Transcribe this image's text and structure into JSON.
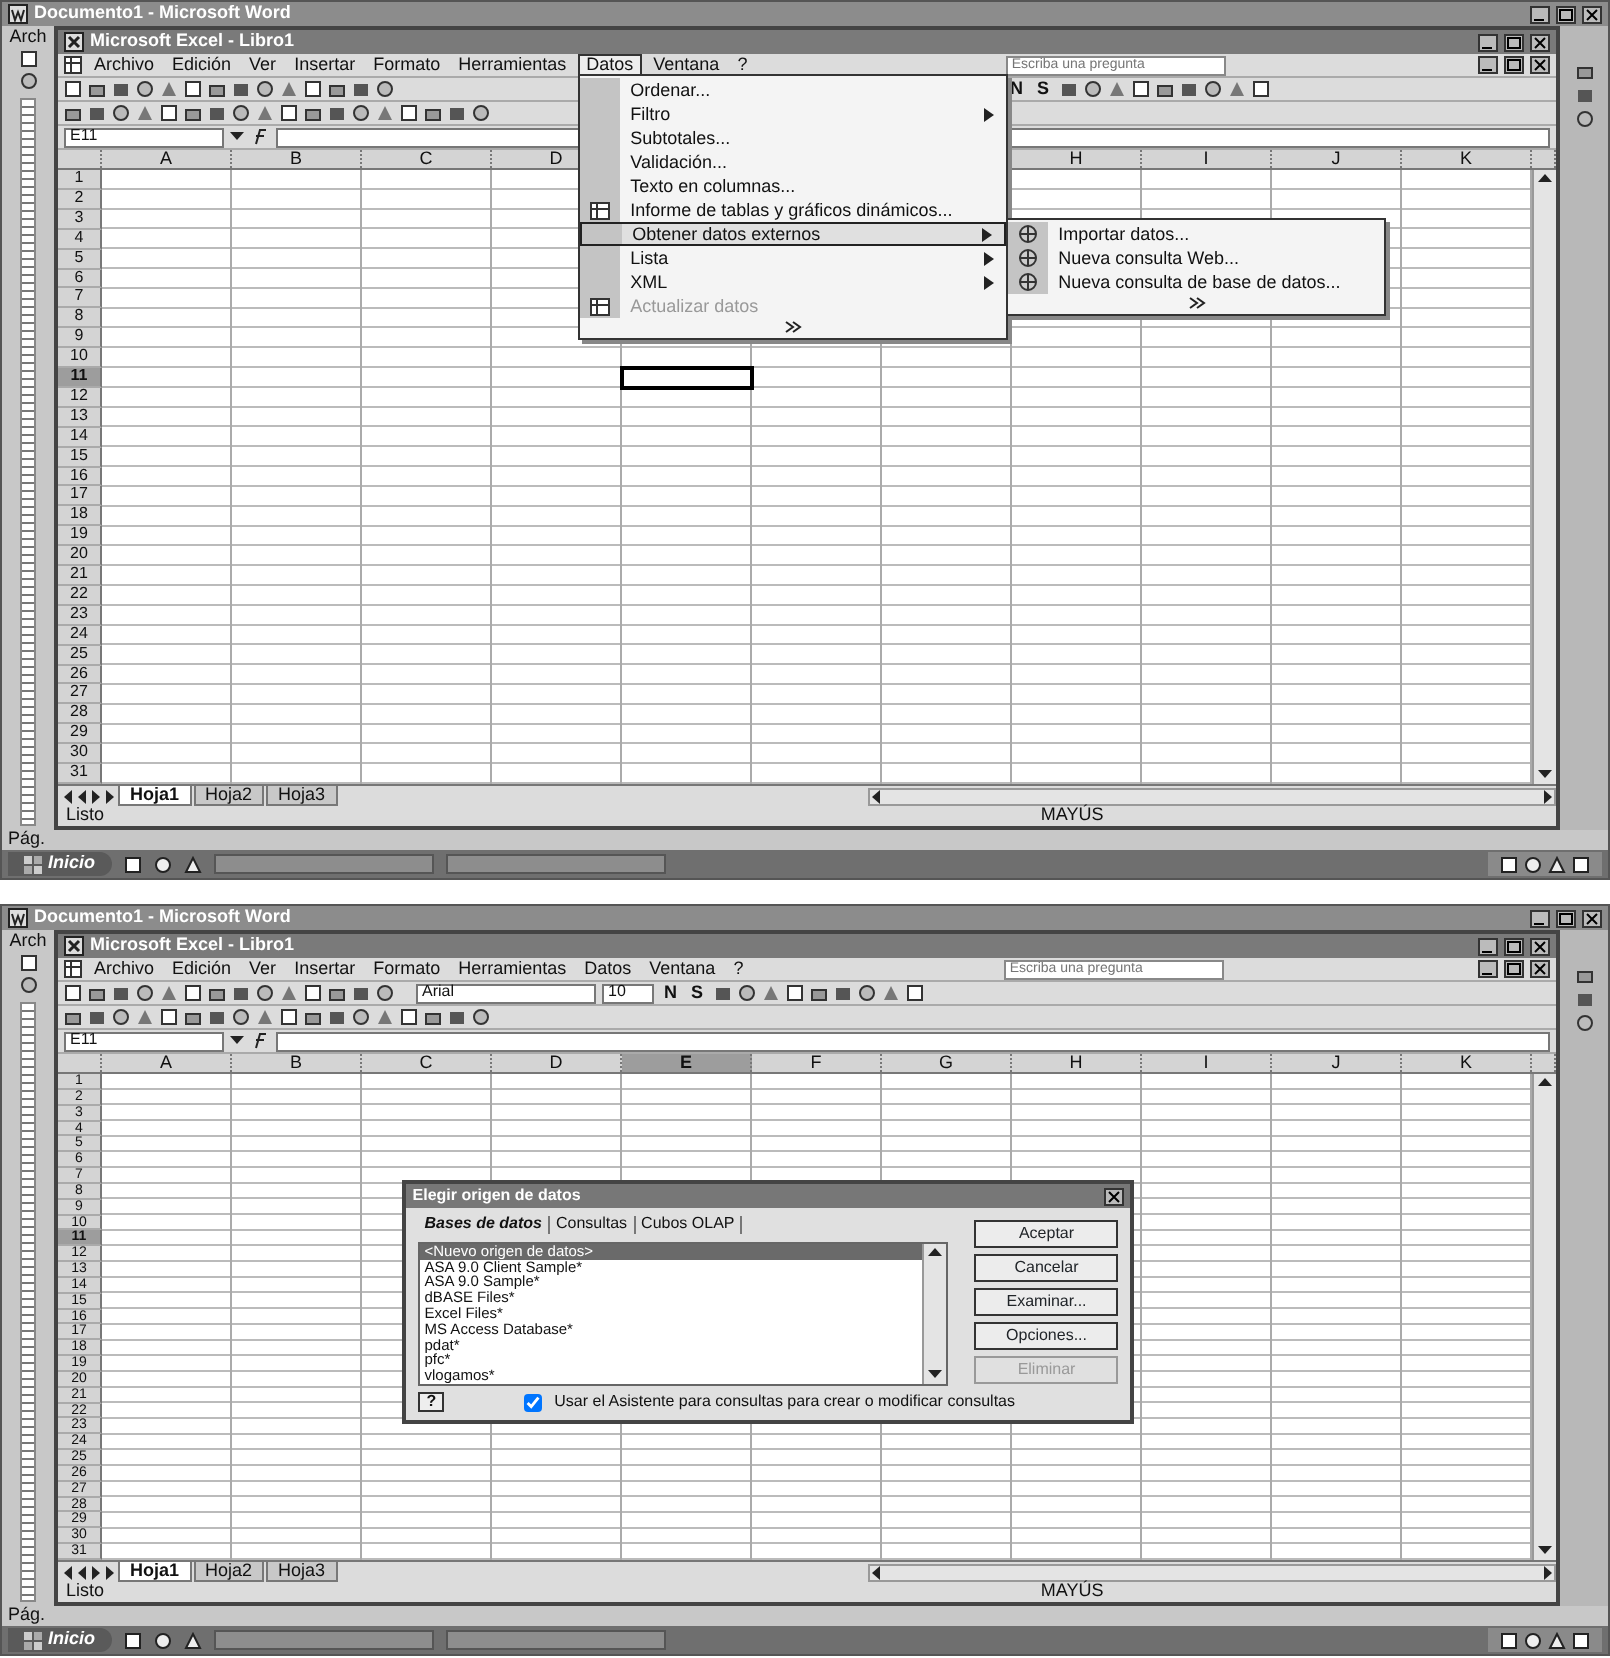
{
  "screens": [
    {
      "word_title": "Documento1 - Microsoft Word",
      "word_menu_fragment": "Arch",
      "excel_title": "Microsoft Excel - Libro1",
      "menu": [
        {
          "label": "Archivo",
          "selected": false
        },
        {
          "label": "Edición",
          "selected": false
        },
        {
          "label": "Ver",
          "selected": false
        },
        {
          "label": "Insertar",
          "selected": false
        },
        {
          "label": "Formato",
          "selected": false
        },
        {
          "label": "Herramientas",
          "selected": false
        },
        {
          "label": "Datos",
          "selected": true
        },
        {
          "label": "Ventana",
          "selected": false
        },
        {
          "label": "?",
          "selected": false
        }
      ],
      "question_placeholder": "Escriba una pregunta",
      "format_buttons": [
        "N",
        "S"
      ],
      "name_box": "E11",
      "columns": [
        {
          "kind": "header",
          "label": "A",
          "selected": false
        },
        {
          "kind": "header",
          "label": "B",
          "selected": false
        },
        {
          "kind": "header",
          "label": "C",
          "selected": false
        },
        {
          "kind": "header",
          "label": "D",
          "selected": false
        },
        {
          "kind": "covered-cursor"
        },
        {
          "kind": "covered"
        },
        {
          "kind": "covered"
        },
        {
          "kind": "header",
          "label": "H",
          "selected": false
        },
        {
          "kind": "header",
          "label": "I",
          "selected": false
        },
        {
          "kind": "header",
          "label": "J",
          "selected": false
        },
        {
          "kind": "header",
          "label": "K",
          "selected": false
        }
      ],
      "rows": [
        {
          "label": "1",
          "selected": false
        },
        {
          "label": "2",
          "selected": false
        },
        {
          "label": "3",
          "selected": false
        },
        {
          "label": "4",
          "selected": false
        },
        {
          "label": "5",
          "selected": false
        },
        {
          "label": "6",
          "selected": false
        },
        {
          "label": "7",
          "selected": false
        },
        {
          "label": "8",
          "selected": false
        },
        {
          "label": "9",
          "selected": false
        },
        {
          "label": "10",
          "selected": false
        },
        {
          "label": "11",
          "selected": true
        },
        {
          "label": "12",
          "selected": false
        },
        {
          "label": "13",
          "selected": false
        },
        {
          "label": "14",
          "selected": false
        },
        {
          "label": "15",
          "selected": false
        },
        {
          "label": "16",
          "selected": false
        },
        {
          "label": "17",
          "selected": false
        },
        {
          "label": "18",
          "selected": false
        },
        {
          "label": "19",
          "selected": false
        },
        {
          "label": "20",
          "selected": false
        },
        {
          "label": "21",
          "selected": false
        },
        {
          "label": "22",
          "selected": false
        },
        {
          "label": "23",
          "selected": false
        },
        {
          "label": "24",
          "selected": false
        },
        {
          "label": "25",
          "selected": false
        },
        {
          "label": "26",
          "selected": false
        },
        {
          "label": "27",
          "selected": false
        },
        {
          "label": "28",
          "selected": false
        },
        {
          "label": "29",
          "selected": false
        },
        {
          "label": "30",
          "selected": false
        },
        {
          "label": "31",
          "selected": false
        }
      ],
      "sheet_tabs": [
        {
          "label": "Hoja1",
          "selected": true
        },
        {
          "label": "Hoja2",
          "selected": false
        },
        {
          "label": "Hoja3",
          "selected": false
        }
      ],
      "status": "Listo",
      "caps": "MAYÚS",
      "word_status": "Pág.",
      "start_button": "Inicio",
      "data_menu": {
        "items": [
          {
            "label": "Ordenar...",
            "submenu": false,
            "selected": false,
            "disabled": false,
            "icon": false
          },
          {
            "label": "Filtro",
            "submenu": true,
            "selected": false,
            "disabled": false,
            "icon": false
          },
          {
            "label": "Subtotales...",
            "submenu": false,
            "selected": false,
            "disabled": false,
            "icon": false
          },
          {
            "label": "Validación...",
            "submenu": false,
            "selected": false,
            "disabled": false,
            "icon": false
          },
          {
            "label": "Texto en columnas...",
            "submenu": false,
            "selected": false,
            "disabled": false,
            "icon": false
          },
          {
            "label": "Informe de tablas y gráficos dinámicos...",
            "submenu": false,
            "selected": false,
            "disabled": false,
            "icon": true
          },
          {
            "label": "Obtener datos externos",
            "submenu": true,
            "selected": true,
            "disabled": false,
            "icon": false
          },
          {
            "label": "Lista",
            "submenu": true,
            "selected": false,
            "disabled": false,
            "icon": false
          },
          {
            "label": "XML",
            "submenu": true,
            "selected": false,
            "disabled": false,
            "icon": false
          },
          {
            "label": "Actualizar datos",
            "submenu": false,
            "selected": false,
            "disabled": true,
            "icon": true
          }
        ],
        "submenu_items": [
          {
            "label": "Importar datos...",
            "icon": true
          },
          {
            "label": "Nueva consulta Web...",
            "icon": true
          },
          {
            "label": "Nueva consulta de base de datos...",
            "icon": true
          }
        ]
      }
    },
    {
      "word_title": "Documento1 - Microsoft Word",
      "word_menu_fragment": "Arch",
      "excel_title": "Microsoft Excel - Libro1",
      "menu": [
        {
          "label": "Archivo",
          "selected": false
        },
        {
          "label": "Edición",
          "selected": false
        },
        {
          "label": "Ver",
          "selected": false
        },
        {
          "label": "Insertar",
          "selected": false
        },
        {
          "label": "Formato",
          "selected": false
        },
        {
          "label": "Herramientas",
          "selected": false
        },
        {
          "label": "Datos",
          "selected": false
        },
        {
          "label": "Ventana",
          "selected": false
        },
        {
          "label": "?",
          "selected": false
        }
      ],
      "question_placeholder": "Escriba una pregunta",
      "font": {
        "name": "Arial",
        "size": "10"
      },
      "format_buttons": [
        "N",
        "S"
      ],
      "name_box": "E11",
      "columns": [
        {
          "kind": "header",
          "label": "A",
          "selected": false
        },
        {
          "kind": "header",
          "label": "B",
          "selected": false
        },
        {
          "kind": "header",
          "label": "C",
          "selected": false
        },
        {
          "kind": "header",
          "label": "D",
          "selected": false
        },
        {
          "kind": "header",
          "label": "E",
          "selected": true
        },
        {
          "kind": "header",
          "label": "F",
          "selected": false
        },
        {
          "kind": "header",
          "label": "G",
          "selected": false
        },
        {
          "kind": "header",
          "label": "H",
          "selected": false
        },
        {
          "kind": "header",
          "label": "I",
          "selected": false
        },
        {
          "kind": "header",
          "label": "J",
          "selected": false
        },
        {
          "kind": "header",
          "label": "K",
          "selected": false
        }
      ],
      "rows": [
        {
          "label": "1",
          "selected": false
        },
        {
          "label": "2",
          "selected": false
        },
        {
          "label": "3",
          "selected": false
        },
        {
          "label": "4",
          "selected": false
        },
        {
          "label": "5",
          "selected": false
        },
        {
          "label": "6",
          "selected": false
        },
        {
          "label": "7",
          "selected": false
        },
        {
          "label": "8",
          "selected": false
        },
        {
          "label": "9",
          "selected": false
        },
        {
          "label": "10",
          "selected": false
        },
        {
          "label": "11",
          "selected": true
        },
        {
          "label": "12",
          "selected": false
        },
        {
          "label": "13",
          "selected": false
        },
        {
          "label": "14",
          "selected": false
        },
        {
          "label": "15",
          "selected": false
        },
        {
          "label": "16",
          "selected": false
        },
        {
          "label": "17",
          "selected": false
        },
        {
          "label": "18",
          "selected": false
        },
        {
          "label": "19",
          "selected": false
        },
        {
          "label": "20",
          "selected": false
        },
        {
          "label": "21",
          "selected": false
        },
        {
          "label": "22",
          "selected": false
        },
        {
          "label": "23",
          "selected": false
        },
        {
          "label": "24",
          "selected": false
        },
        {
          "label": "25",
          "selected": false
        },
        {
          "label": "26",
          "selected": false
        },
        {
          "label": "27",
          "selected": false
        },
        {
          "label": "28",
          "selected": false
        },
        {
          "label": "29",
          "selected": false
        },
        {
          "label": "30",
          "selected": false
        },
        {
          "label": "31",
          "selected": false
        }
      ],
      "sheet_tabs": [
        {
          "label": "Hoja1",
          "selected": true
        },
        {
          "label": "Hoja2",
          "selected": false
        },
        {
          "label": "Hoja3",
          "selected": false
        }
      ],
      "status": "Listo",
      "caps": "MAYÚS",
      "word_status": "Pág.",
      "start_button": "Inicio",
      "dialog": {
        "title": "Elegir origen de datos",
        "tabs": [
          {
            "label": "Bases de datos",
            "selected": true
          },
          {
            "label": "Consultas",
            "selected": false
          },
          {
            "label": "Cubos OLAP",
            "selected": false
          }
        ],
        "sources": [
          {
            "label": "<Nuevo origen de datos>",
            "selected": true
          },
          {
            "label": "ASA 9.0 Client Sample*",
            "selected": false
          },
          {
            "label": "ASA 9.0 Sample*",
            "selected": false
          },
          {
            "label": "dBASE Files*",
            "selected": false
          },
          {
            "label": "Excel Files*",
            "selected": false
          },
          {
            "label": "MS Access Database*",
            "selected": false
          },
          {
            "label": "pdat*",
            "selected": false
          },
          {
            "label": "pfc*",
            "selected": false
          },
          {
            "label": "vlogamos*",
            "selected": false
          }
        ],
        "buttons": [
          {
            "label": "Aceptar",
            "disabled": false
          },
          {
            "label": "Cancelar",
            "disabled": false
          },
          {
            "label": "Examinar...",
            "disabled": false
          },
          {
            "label": "Opciones...",
            "disabled": false
          },
          {
            "label": "Eliminar",
            "disabled": true
          }
        ],
        "help": "?",
        "wizard": {
          "label": "Usar el Asistente para consultas para crear o modificar consultas",
          "checked": true
        }
      }
    }
  ]
}
